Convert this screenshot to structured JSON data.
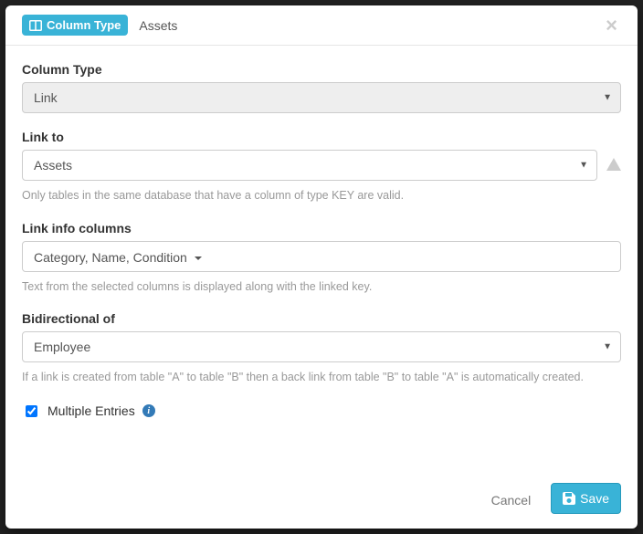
{
  "header": {
    "badge_label": "Column Type",
    "title": "Assets"
  },
  "fields": {
    "column_type": {
      "label": "Column Type",
      "value": "Link"
    },
    "link_to": {
      "label": "Link to",
      "value": "Assets",
      "help": "Only tables in the same database that have a column of type KEY are valid."
    },
    "link_info_columns": {
      "label": "Link info columns",
      "value": "Category, Name, Condition",
      "help": "Text from the selected columns is displayed along with the linked key."
    },
    "bidirectional_of": {
      "label": "Bidirectional of",
      "value": "Employee",
      "help": "If a link is created from table \"A\" to table \"B\" then a back link from table \"B\" to table \"A\" is automatically created."
    },
    "multiple_entries": {
      "label": "Multiple Entries"
    }
  },
  "footer": {
    "cancel": "Cancel",
    "save": "Save"
  }
}
